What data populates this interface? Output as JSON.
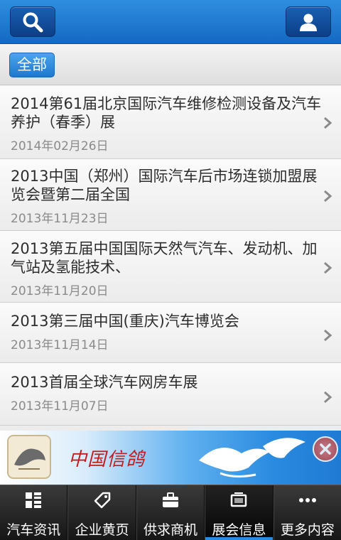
{
  "header": {
    "search_icon": "search-icon",
    "user_icon": "user-icon"
  },
  "filter": {
    "selected_label": "全部"
  },
  "list": {
    "items": [
      {
        "title": "2014第61届北京国际汽车维修检测设备及汽车养护（春季）展",
        "date": "2014年02月26日"
      },
      {
        "title": "2013中国（郑州）国际汽车后市场连锁加盟展览会暨第二届全国",
        "date": "2013年11月23日"
      },
      {
        "title": "2013第五届中国国际天然气汽车、发动机、加气站及氢能技术、",
        "date": "2013年11月20日"
      },
      {
        "title": "2013第三届中国(重庆)汽车博览会",
        "date": "2013年11月14日"
      },
      {
        "title": "2013首届全球汽车网房车展",
        "date": "2013年11月07日"
      }
    ]
  },
  "ad": {
    "brand_text": "中国信鸽",
    "close_icon": "close-icon"
  },
  "tabbar": {
    "tabs": [
      {
        "label": "汽车资讯",
        "icon": "grid-icon"
      },
      {
        "label": "企业黄页",
        "icon": "tag-icon"
      },
      {
        "label": "供求商机",
        "icon": "briefcase-icon"
      },
      {
        "label": "展会信息",
        "icon": "display-icon",
        "active": true
      },
      {
        "label": "更多内容",
        "icon": "more-icon"
      }
    ]
  },
  "colors": {
    "header_blue": "#1f7ad3",
    "active_accent": "#2a8ae0"
  }
}
